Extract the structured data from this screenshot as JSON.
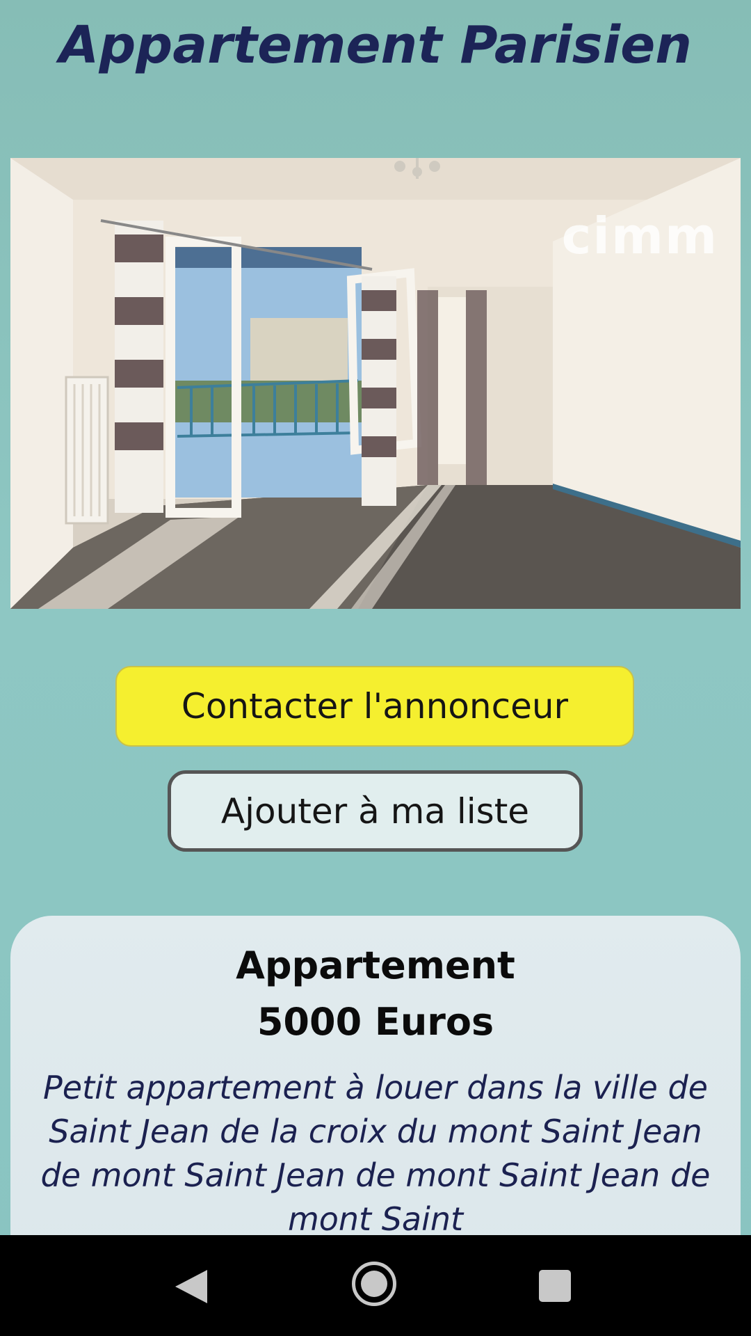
{
  "app": {
    "title": "Appartement Parisien"
  },
  "photo": {
    "watermark": "cimm",
    "alt": "Living room photo"
  },
  "buttons": {
    "contact_label": "Contacter l'annonceur",
    "add_label": "Ajouter à ma liste"
  },
  "listing": {
    "type": "Appartement",
    "price": "5000 Euros",
    "description": "Petit appartement à louer dans la ville de Saint Jean de la croix du mont Saint Jean de mont Saint Jean de mont Saint Jean de mont Saint"
  },
  "colors": {
    "background": "#8ec7c3",
    "title": "#1c2457",
    "contact_button": "#f5ef2f",
    "add_button": "#e1eeee",
    "card": "#dfe9ed",
    "navbar": "#000000"
  },
  "navbar": {
    "icons": [
      "back-icon",
      "home-icon",
      "recent-apps-icon"
    ]
  }
}
